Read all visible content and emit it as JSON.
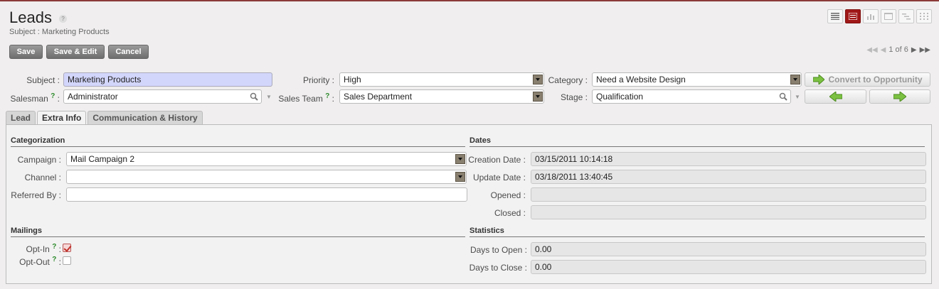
{
  "header": {
    "title": "Leads",
    "help": "?",
    "subtitle": "Subject : Marketing Products"
  },
  "view_switcher": {
    "items": [
      "list-view",
      "form-view",
      "graph-view",
      "calendar-view",
      "gantt-view",
      "diagram-view"
    ],
    "active": "form-view",
    "active_color": "#a01818"
  },
  "toolbar": {
    "save_label": "Save",
    "save_edit_label": "Save & Edit",
    "cancel_label": "Cancel"
  },
  "pager": {
    "label": "1 of 6"
  },
  "form": {
    "subject": {
      "label": "Subject :",
      "value": "Marketing Products"
    },
    "salesman": {
      "label": "Salesman",
      "help": "?",
      "colon": ":",
      "value": "Administrator"
    },
    "priority": {
      "label": "Priority :",
      "value": "High"
    },
    "sales_team": {
      "label": "Sales Team",
      "help": "?",
      "colon": ":",
      "value": "Sales Department"
    },
    "category": {
      "label": "Category :",
      "value": "Need a Website Design"
    },
    "stage": {
      "label": "Stage :",
      "value": "Qualification"
    },
    "convert_label": "Convert to Opportunity"
  },
  "tabs": [
    {
      "label": "Lead"
    },
    {
      "label": "Extra Info"
    },
    {
      "label": "Communication & History"
    }
  ],
  "active_tab": "Extra Info",
  "categorization": {
    "title": "Categorization",
    "campaign": {
      "label": "Campaign :",
      "value": "Mail Campaign 2"
    },
    "channel": {
      "label": "Channel :",
      "value": ""
    },
    "referred_by": {
      "label": "Referred By :",
      "value": ""
    }
  },
  "dates": {
    "title": "Dates",
    "creation_date": {
      "label": "Creation Date :",
      "value": "03/15/2011 10:14:18"
    },
    "update_date": {
      "label": "Update Date :",
      "value": "03/18/2011 13:40:45"
    },
    "opened": {
      "label": "Opened :",
      "value": ""
    },
    "closed": {
      "label": "Closed :",
      "value": ""
    }
  },
  "mailings": {
    "title": "Mailings",
    "opt_in": {
      "label": "Opt-In",
      "help": "?",
      "colon": ":",
      "checked": true
    },
    "opt_out": {
      "label": "Opt-Out",
      "help": "?",
      "colon": ":",
      "checked": false
    }
  },
  "statistics": {
    "title": "Statistics",
    "days_to_open": {
      "label": "Days to Open :",
      "value": "0.00"
    },
    "days_to_close": {
      "label": "Days to Close :",
      "value": "0.00"
    }
  }
}
